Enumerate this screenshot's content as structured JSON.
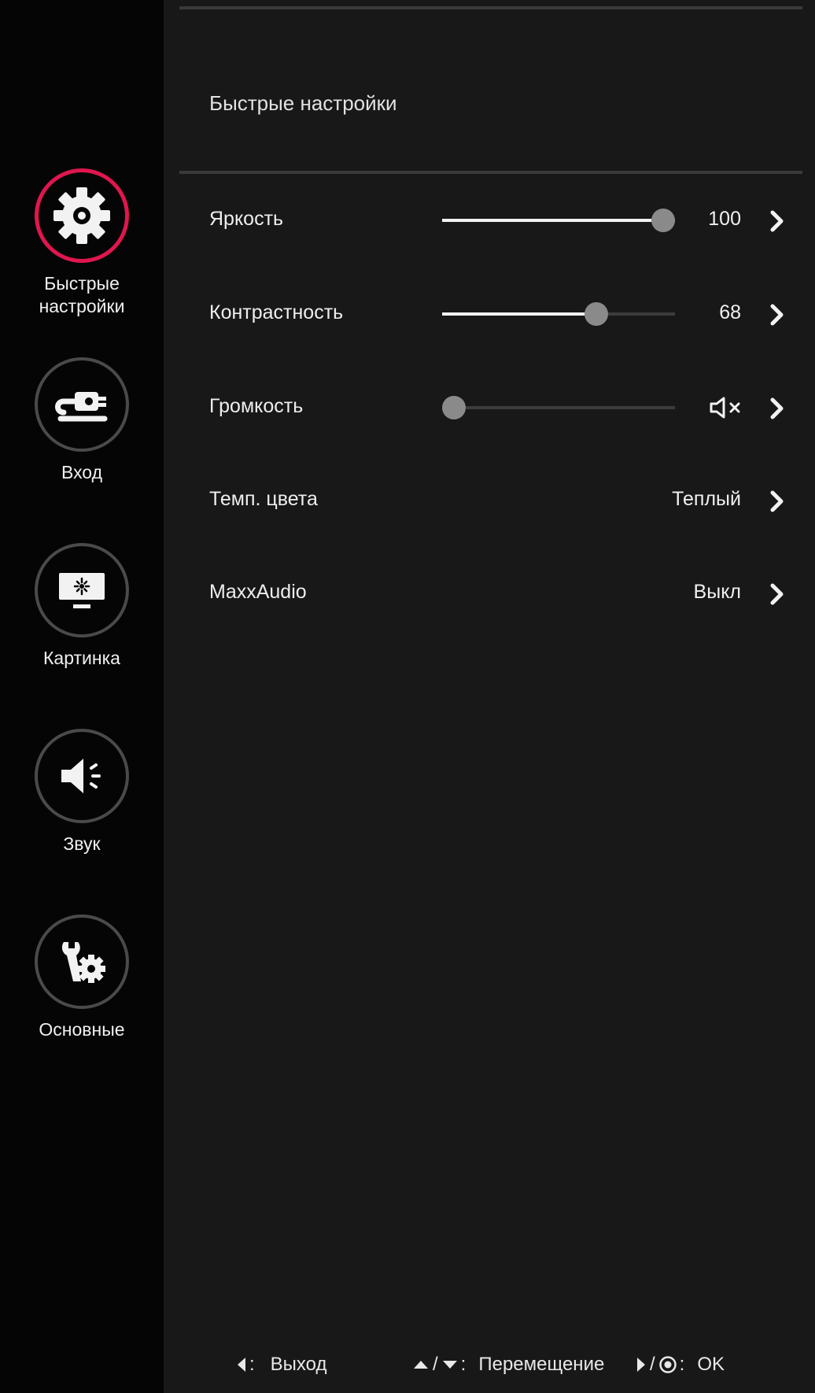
{
  "sidebar": {
    "items": [
      {
        "label": "Быстрые\nнастройки",
        "icon": "gear-icon",
        "active": true
      },
      {
        "label": "Вход",
        "icon": "input-cable-icon",
        "active": false
      },
      {
        "label": "Картинка",
        "icon": "monitor-brightness-icon",
        "active": false
      },
      {
        "label": "Звук",
        "icon": "speaker-icon",
        "active": false
      },
      {
        "label": "Основные",
        "icon": "wrench-gear-icon",
        "active": false
      }
    ]
  },
  "main": {
    "title": "Быстрые настройки",
    "rows": [
      {
        "label": "Яркость",
        "value": "100",
        "level": 1.0
      },
      {
        "label": "Контрастность",
        "value": "68",
        "level": 0.68
      },
      {
        "label": "Громкость",
        "level": 0.0,
        "value_icon": "mute-icon"
      },
      {
        "label": "Темп. цвета",
        "value": "Теплый"
      },
      {
        "label": "MaxxAudio",
        "value": "Выкл"
      }
    ]
  },
  "footer": {
    "exit_sep": ":",
    "exit_label": "Выход",
    "nav_slash": "/",
    "nav_sep": ":",
    "nav_label": "Перемещение",
    "ok_slash": "/",
    "ok_sep": ":",
    "ok_label": "OK"
  },
  "colors": {
    "accent": "#e0164f",
    "background": "#181818",
    "sidebar": "#050505"
  }
}
